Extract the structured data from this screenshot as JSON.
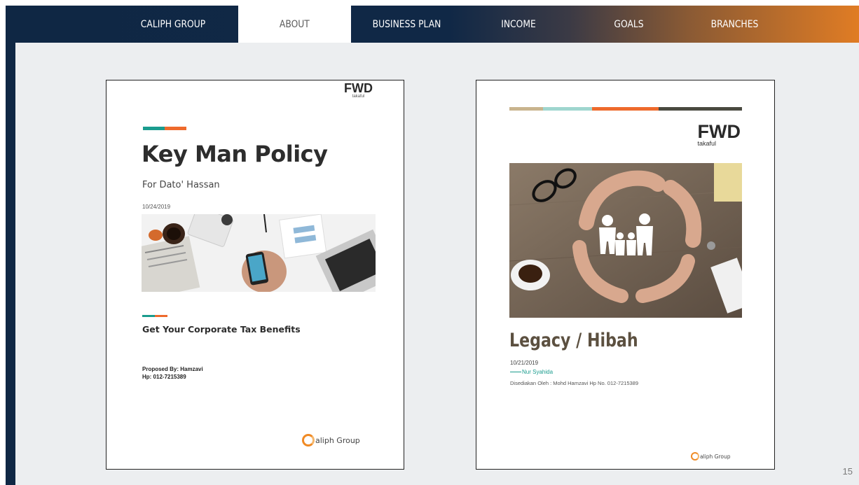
{
  "nav": {
    "items": [
      {
        "label": "CALIPH GROUP",
        "active": false
      },
      {
        "label": "ABOUT",
        "active": true
      },
      {
        "label": "BUSINESS PLAN",
        "active": false
      },
      {
        "label": "INCOME",
        "active": false
      },
      {
        "label": "GOALS",
        "active": false
      },
      {
        "label": "BRANCHES",
        "active": false
      }
    ]
  },
  "page_number": "15",
  "colors": {
    "navy": "#0f2744",
    "orange": "#e07c24",
    "teal": "#1a9c8e",
    "accent_orange": "#ee6a2c",
    "brown_title": "#5c5040"
  },
  "doc1": {
    "logo": {
      "brand": "FWD",
      "sub": "takaful"
    },
    "title": "Key Man Policy",
    "subtitle": "For Dato' Hassan",
    "date": "10/24/2019",
    "tagline": "Get Your Corporate Tax Benefits",
    "proposed_by": "Proposed By: Hamzavi",
    "phone": "Hp: 012-7215389",
    "footer_logo": {
      "text": "aliph Group"
    }
  },
  "doc2": {
    "logo": {
      "brand": "FWD",
      "sub": "takaful"
    },
    "title": "Legacy / Hibah",
    "date": "10/21/2019",
    "recipient": "Nur Syahida",
    "prepared_by": "Disediakan Oleh : Mohd Hamzavi   Hp No. 012-7215389",
    "footer_logo": {
      "text": "aliph Group"
    }
  }
}
